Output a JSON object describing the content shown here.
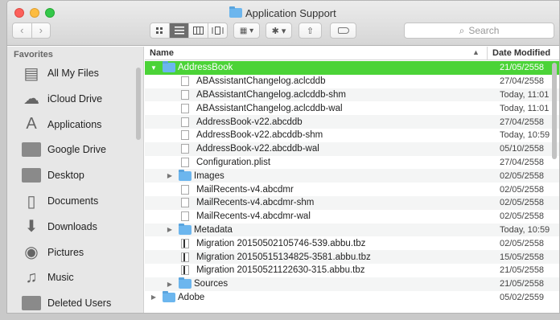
{
  "window": {
    "title": "Application Support"
  },
  "toolbar": {
    "back_label": "‹",
    "forward_label": "›",
    "arrange_label": "▦ ▾",
    "action_label": "✱ ▾",
    "share_label": "⇧",
    "search_placeholder": "Search"
  },
  "sidebar": {
    "heading": "Favorites",
    "items": [
      {
        "label": "All My Files",
        "icon": "all-files-icon"
      },
      {
        "label": "iCloud Drive",
        "icon": "cloud-icon"
      },
      {
        "label": "Applications",
        "icon": "applications-icon"
      },
      {
        "label": "Google Drive",
        "icon": "folder-icon"
      },
      {
        "label": "Desktop",
        "icon": "desktop-icon"
      },
      {
        "label": "Documents",
        "icon": "documents-icon"
      },
      {
        "label": "Downloads",
        "icon": "downloads-icon"
      },
      {
        "label": "Pictures",
        "icon": "camera-icon"
      },
      {
        "label": "Music",
        "icon": "music-note-icon"
      },
      {
        "label": "Deleted Users",
        "icon": "folder-icon"
      }
    ]
  },
  "columns": {
    "name": "Name",
    "date": "Date Modified"
  },
  "rows": [
    {
      "name": "AddressBook",
      "date": "21/05/2558",
      "kind": "folder",
      "expanded": true,
      "depth": 0,
      "selected": true
    },
    {
      "name": "ABAssistantChangelog.aclcddb",
      "date": "27/04/2558",
      "kind": "file",
      "depth": 1
    },
    {
      "name": "ABAssistantChangelog.aclcddb-shm",
      "date": "Today, 11:01",
      "kind": "file",
      "depth": 1
    },
    {
      "name": "ABAssistantChangelog.aclcddb-wal",
      "date": "Today, 11:01",
      "kind": "file",
      "depth": 1
    },
    {
      "name": "AddressBook-v22.abcddb",
      "date": "27/04/2558",
      "kind": "file",
      "depth": 1
    },
    {
      "name": "AddressBook-v22.abcddb-shm",
      "date": "Today, 10:59",
      "kind": "file",
      "depth": 1
    },
    {
      "name": "AddressBook-v22.abcddb-wal",
      "date": "05/10/2558",
      "kind": "file",
      "depth": 1
    },
    {
      "name": "Configuration.plist",
      "date": "27/04/2558",
      "kind": "file",
      "depth": 1
    },
    {
      "name": "Images",
      "date": "02/05/2558",
      "kind": "folder",
      "expanded": false,
      "depth": 1
    },
    {
      "name": "MailRecents-v4.abcdmr",
      "date": "02/05/2558",
      "kind": "file",
      "depth": 1
    },
    {
      "name": "MailRecents-v4.abcdmr-shm",
      "date": "02/05/2558",
      "kind": "file",
      "depth": 1
    },
    {
      "name": "MailRecents-v4.abcdmr-wal",
      "date": "02/05/2558",
      "kind": "file",
      "depth": 1
    },
    {
      "name": "Metadata",
      "date": "Today, 10:59",
      "kind": "folder",
      "expanded": false,
      "depth": 1
    },
    {
      "name": "Migration 20150502105746-539.abbu.tbz",
      "date": "02/05/2558",
      "kind": "exec",
      "depth": 1
    },
    {
      "name": "Migration 20150515134825-3581.abbu.tbz",
      "date": "15/05/2558",
      "kind": "exec",
      "depth": 1
    },
    {
      "name": "Migration 20150521122630-315.abbu.tbz",
      "date": "21/05/2558",
      "kind": "exec",
      "depth": 1
    },
    {
      "name": "Sources",
      "date": "21/05/2558",
      "kind": "folder",
      "expanded": false,
      "depth": 1
    },
    {
      "name": "Adobe",
      "date": "05/02/2559",
      "kind": "folder",
      "expanded": false,
      "depth": 0
    }
  ],
  "colors": {
    "selection": "#4bd337",
    "folder": "#6cb6ee"
  }
}
